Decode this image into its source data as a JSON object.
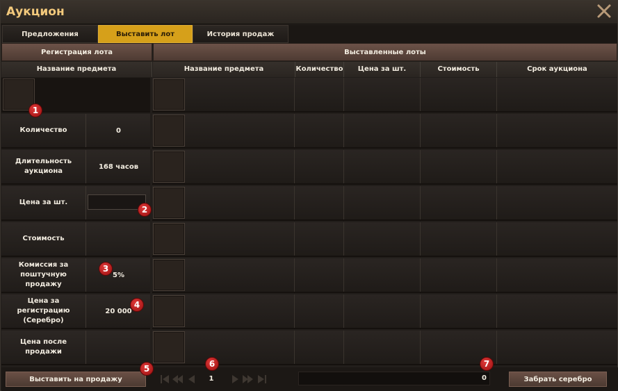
{
  "window": {
    "title": "Аукцион"
  },
  "tabs": [
    {
      "label": "Предложения",
      "active": false
    },
    {
      "label": "Выставить лот",
      "active": true
    },
    {
      "label": "История продаж",
      "active": false
    }
  ],
  "registration": {
    "header": "Регистрация лота",
    "column_header": "Название предмета",
    "rows": [
      {
        "label": "Количество",
        "value": "0"
      },
      {
        "label": "Длительность аукциона",
        "value": "168 часов"
      },
      {
        "label": "Цена за шт.",
        "value": ""
      },
      {
        "label": "Стоимость",
        "value": ""
      },
      {
        "label": "Комиссия за поштучную продажу",
        "value": "5%"
      },
      {
        "label": "Цена за регистрацию (Серебро)",
        "value": "20 000"
      },
      {
        "label": "Цена после продажи",
        "value": ""
      }
    ],
    "submit_label": "Выставить на продажу"
  },
  "lots": {
    "header": "Выставленные лоты",
    "columns": [
      "Название предмета",
      "Количество",
      "Цена за шт.",
      "Стоимость",
      "Срок аукциона"
    ],
    "rows": []
  },
  "pager": {
    "page": "1"
  },
  "silver": {
    "value": "0",
    "collect_label": "Забрать серебро"
  },
  "markers": [
    "1",
    "2",
    "3",
    "4",
    "5",
    "6",
    "7"
  ],
  "colors": {
    "accent": "#d6a01a",
    "title": "#f3c97c",
    "marker": "#c51f1f"
  }
}
